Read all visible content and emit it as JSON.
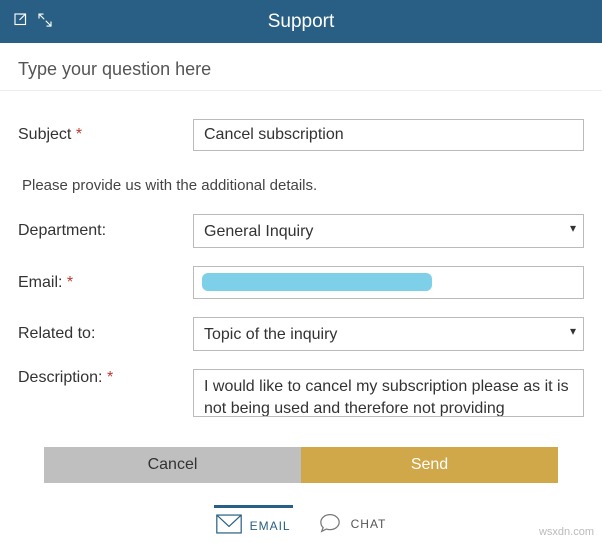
{
  "header": {
    "title": "Support"
  },
  "question": {
    "placeholder": "Type your question here"
  },
  "instruction": "Please provide us with the additional details.",
  "fields": {
    "subject": {
      "label": "Subject",
      "required": true,
      "value": "Cancel subscription"
    },
    "department": {
      "label": "Department:",
      "required": false,
      "value": "General Inquiry"
    },
    "email": {
      "label": "Email:",
      "required": true,
      "value": ""
    },
    "related_to": {
      "label": "Related to:",
      "required": false,
      "value": "Topic of the inquiry"
    },
    "description": {
      "label": "Description:",
      "required": true,
      "value": "I would like to cancel my subscription please as it is not being used and therefore not providing"
    }
  },
  "buttons": {
    "cancel": "Cancel",
    "send": "Send"
  },
  "footer": {
    "email_tab": "EMAIL",
    "chat_tab": "CHAT"
  },
  "watermark": "wsxdn.com"
}
